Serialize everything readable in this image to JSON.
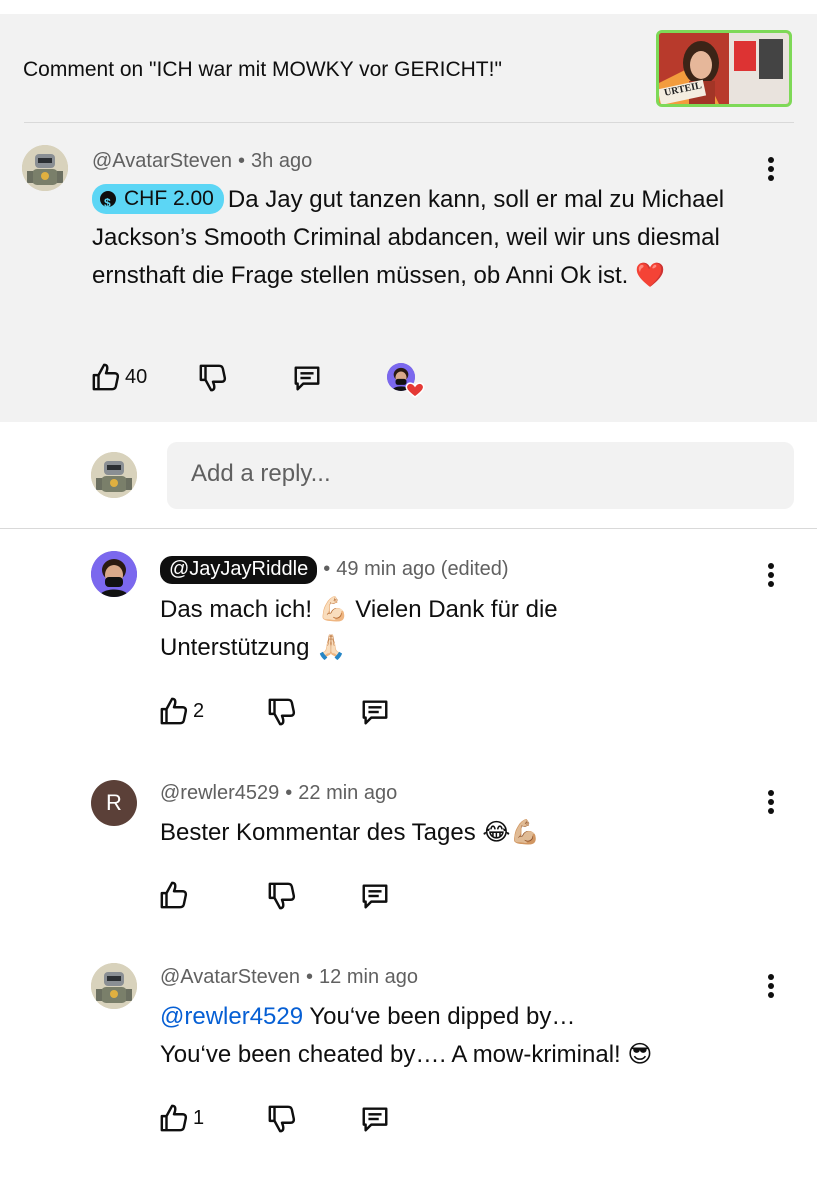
{
  "header": {
    "title": "Comment on \"ICH war mit MOWKY vor GERICHT!\"",
    "thumbnail_text": "URTEIL"
  },
  "main_comment": {
    "author": "@AvatarSteven",
    "separator": "•",
    "time": "3h ago",
    "donation": "CHF 2.00",
    "text": "Da Jay gut tanzen kann, soll er mal zu Michael Jackson’s Smooth Criminal abdancen, weil wir uns diesmal ernsthaft die Frage stellen müssen, ob Anni Ok ist. ❤️",
    "likes": "40"
  },
  "reply_box": {
    "placeholder": "Add a reply..."
  },
  "replies": [
    {
      "author": "@JayJayRiddle",
      "time": "49 min ago (edited)",
      "text_line1": "Das mach ich! 💪🏻 Vielen Dank für die",
      "text_line2": "Unterstützung 🙏🏻",
      "likes": "2"
    },
    {
      "author": "@rewler4529",
      "avatar_letter": "R",
      "time": "22 min ago",
      "text": "Bester Kommentar des Tages 😂💪🏼",
      "likes": ""
    },
    {
      "author": "@AvatarSteven",
      "time": "12 min ago",
      "mention": "@rewler4529",
      "text_line1": " You‘ve been dipped by…",
      "text_line2": "You‘ve been cheated by…. A mow-kriminal! 😎",
      "likes": "1"
    }
  ],
  "separator": "•",
  "colors": {
    "panel_bg": "#f2f2f2",
    "link_blue": "#065fd4",
    "donation_badge": "#5cd6f5",
    "creator_badge": "#0f0f0f",
    "heart": "#e53935"
  }
}
